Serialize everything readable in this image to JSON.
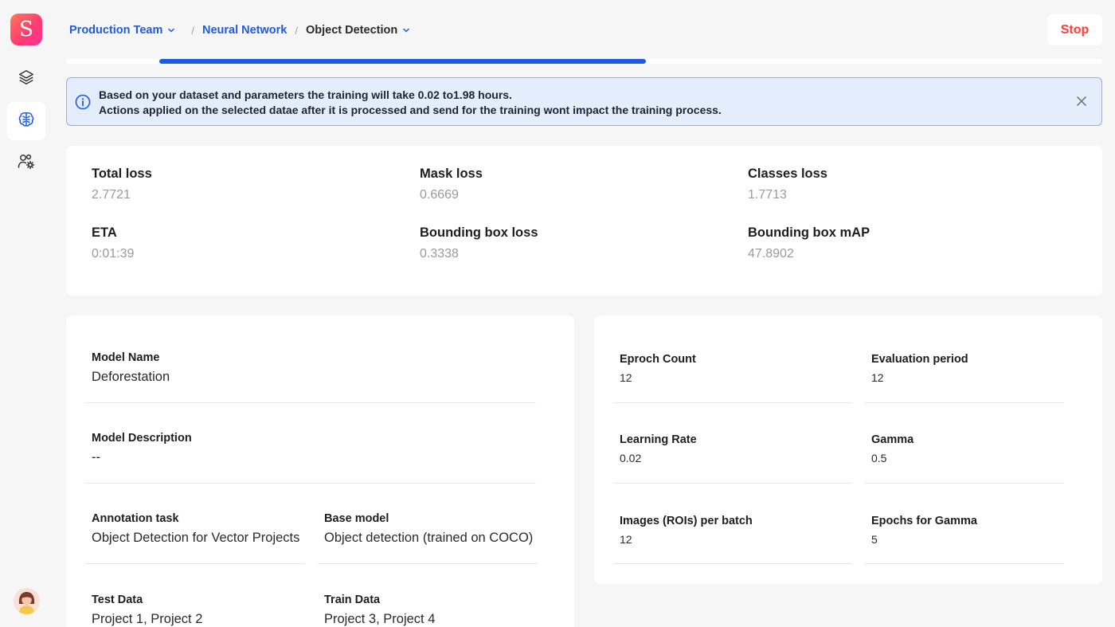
{
  "app": {
    "logo_letter": "S",
    "brand_gradient": [
      "#ff7a59",
      "#ff2e9a"
    ],
    "accent": "#1f5be0",
    "danger": "#ff3b3b"
  },
  "sidebar": {
    "items": [
      {
        "icon": "layers-icon",
        "active": false
      },
      {
        "icon": "brain-icon",
        "active": true
      },
      {
        "icon": "users-settings-icon",
        "active": false
      }
    ],
    "avatar": "user-avatar"
  },
  "breadcrumb": {
    "team": "Production Team",
    "section": "Neural Network",
    "current": "Object Detection",
    "separator": "/"
  },
  "header": {
    "stop_label": "Stop"
  },
  "progress": {
    "fraction": 0.47
  },
  "banner": {
    "line1": "Based on your dataset and parameters the training will take 0.02 to1.98 hours.",
    "line2": "Actions applied on the selected datae after it is processed and send for the training wont impact the training process."
  },
  "metrics": [
    {
      "label": "Total loss",
      "value": "2.7721"
    },
    {
      "label": "Mask loss",
      "value": "0.6669"
    },
    {
      "label": "Classes loss",
      "value": "1.7713"
    },
    {
      "label": "ETA",
      "value": "0:01:39"
    },
    {
      "label": "Bounding box loss",
      "value": "0.3338"
    },
    {
      "label": "Bounding box mAP",
      "value": "47.8902"
    }
  ],
  "model": {
    "name_label": "Model Name",
    "name_value": "Deforestation",
    "desc_label": "Model Description",
    "desc_value": "--",
    "task_label": "Annotation task",
    "task_value": "Object Detection for Vector Projects",
    "base_label": "Base model",
    "base_value": "Object detection (trained on COCO)",
    "test_label": "Test Data",
    "test_value": "Project 1, Project 2",
    "train_label": "Train Data",
    "train_value": "Project 3, Project 4"
  },
  "params": [
    {
      "label": "Eproch Count",
      "value": "12"
    },
    {
      "label": "Evaluation period",
      "value": "12"
    },
    {
      "label": "Learning Rate",
      "value": "0.02"
    },
    {
      "label": "Gamma",
      "value": "0.5"
    },
    {
      "label": "Images (ROIs) per batch",
      "value": "12"
    },
    {
      "label": "Epochs for Gamma",
      "value": "5"
    }
  ]
}
